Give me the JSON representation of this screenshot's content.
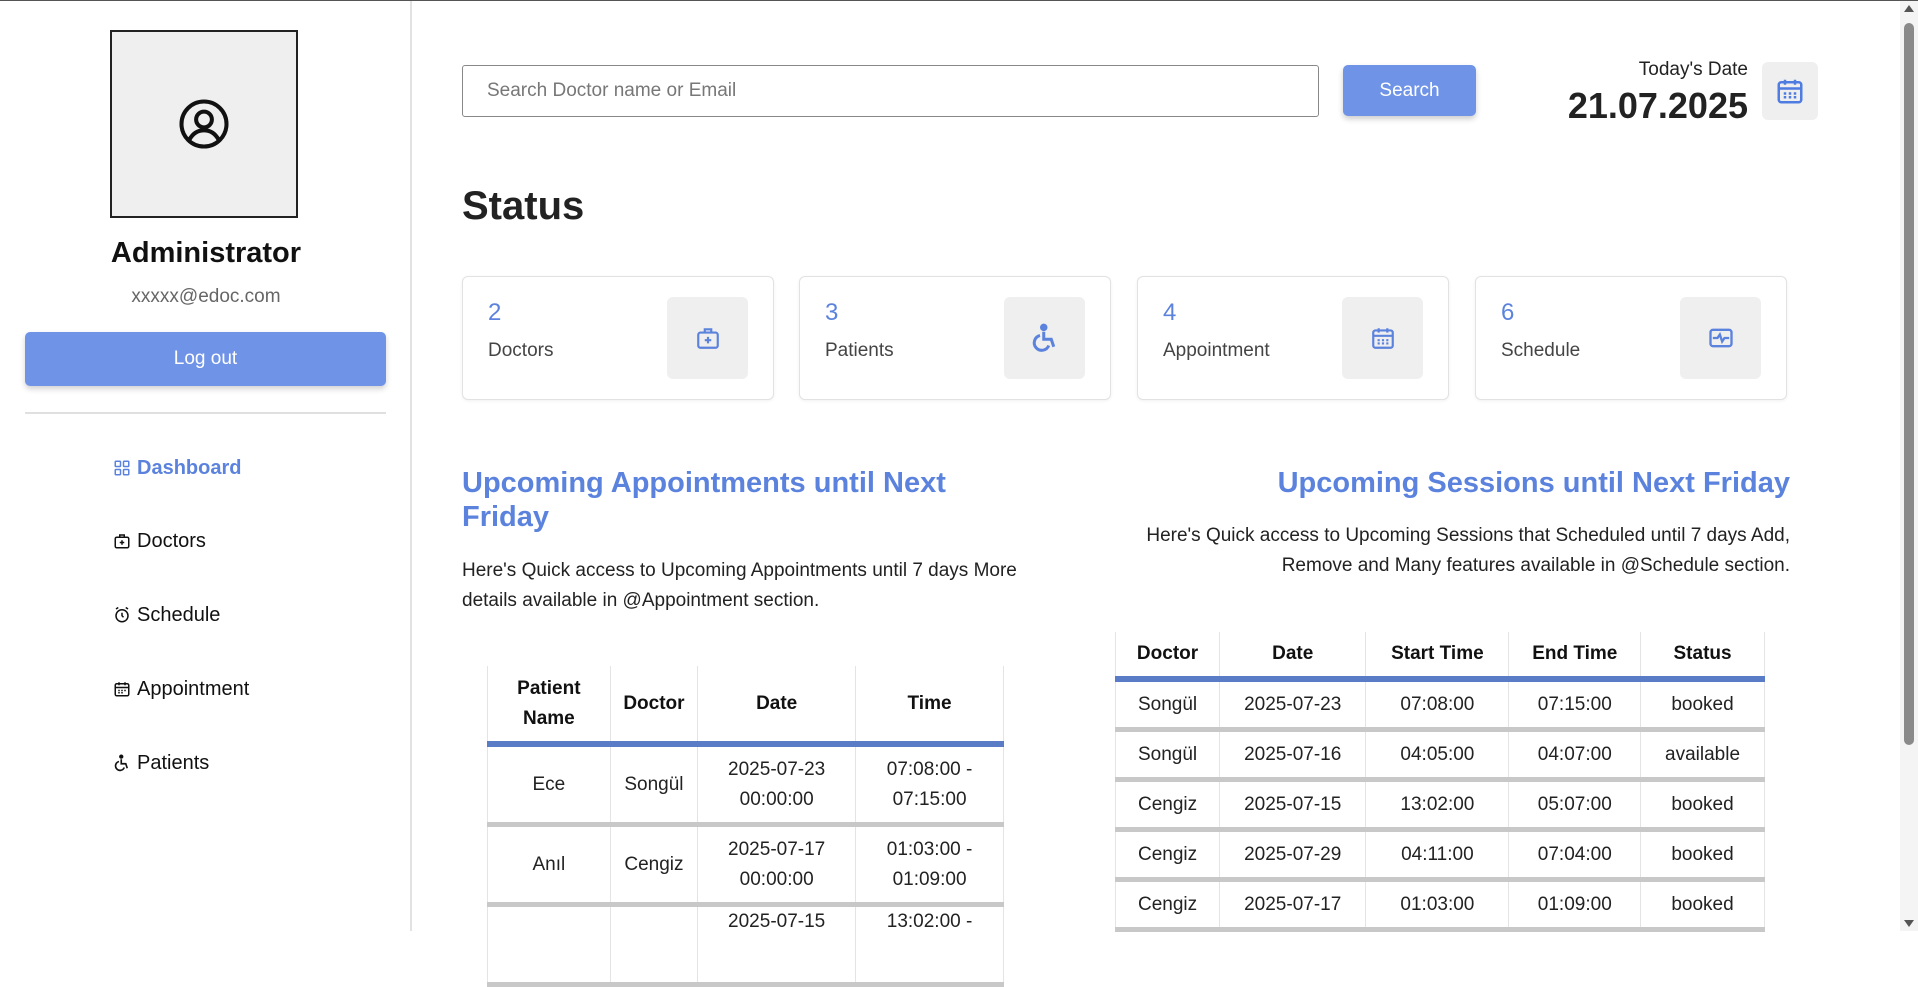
{
  "sidebar": {
    "avatar_icon": "user-circle-icon",
    "name": "Administrator",
    "email": "xxxxx@edoc.com",
    "logout_label": "Log out",
    "items": [
      {
        "label": "Dashboard",
        "icon": "dashboard-icon",
        "active": true
      },
      {
        "label": "Doctors",
        "icon": "doctor-icon",
        "active": false
      },
      {
        "label": "Schedule",
        "icon": "alarm-clock-icon",
        "active": false
      },
      {
        "label": "Appointment",
        "icon": "calendar-icon",
        "active": false
      },
      {
        "label": "Patients",
        "icon": "wheelchair-icon",
        "active": false
      }
    ]
  },
  "header": {
    "search_placeholder": "Search Doctor name or Email",
    "search_label": "Search",
    "today_label": "Today's Date",
    "today_date": "21.07.2025"
  },
  "status": {
    "title": "Status",
    "cards": [
      {
        "value": "2",
        "label": "Doctors",
        "icon": "medical-bag-icon"
      },
      {
        "value": "3",
        "label": "Patients",
        "icon": "wheelchair-icon"
      },
      {
        "value": "4",
        "label": "Appointment",
        "icon": "calendar-icon"
      },
      {
        "value": "6",
        "label": "Schedule",
        "icon": "pulse-icon"
      }
    ]
  },
  "appointments": {
    "title": "Upcoming Appointments until Next Friday",
    "desc": "Here's Quick access to Upcoming Appointments until 7 days More details available in @Appointment section.",
    "columns": [
      "Patient Name",
      "Doctor",
      "Date",
      "Time"
    ],
    "rows": [
      [
        "Ece",
        "Songül",
        "2025-07-23 00:00:00",
        "07:08:00 - 07:15:00"
      ],
      [
        "Anıl",
        "Cengiz",
        "2025-07-17 00:00:00",
        "01:03:00 - 01:09:00"
      ],
      [
        "",
        "",
        "2025-07-15",
        "13:02:00 -"
      ]
    ]
  },
  "sessions": {
    "title": "Upcoming Sessions until Next Friday",
    "desc": "Here's Quick access to Upcoming Sessions that Scheduled until 7 days Add, Remove and Many features available in @Schedule section.",
    "columns": [
      "Doctor",
      "Date",
      "Start Time",
      "End Time",
      "Status"
    ],
    "rows": [
      [
        "Songül",
        "2025-07-23",
        "07:08:00",
        "07:15:00",
        "booked"
      ],
      [
        "Songül",
        "2025-07-16",
        "04:05:00",
        "04:07:00",
        "available"
      ],
      [
        "Cengiz",
        "2025-07-15",
        "13:02:00",
        "05:07:00",
        "booked"
      ],
      [
        "Cengiz",
        "2025-07-29",
        "04:11:00",
        "07:04:00",
        "booked"
      ],
      [
        "Cengiz",
        "2025-07-17",
        "01:03:00",
        "01:09:00",
        "booked"
      ]
    ]
  },
  "colors": {
    "accent": "#6f93e6",
    "accent_text": "#5b82dd",
    "header_rule": "#5a7bc6"
  }
}
